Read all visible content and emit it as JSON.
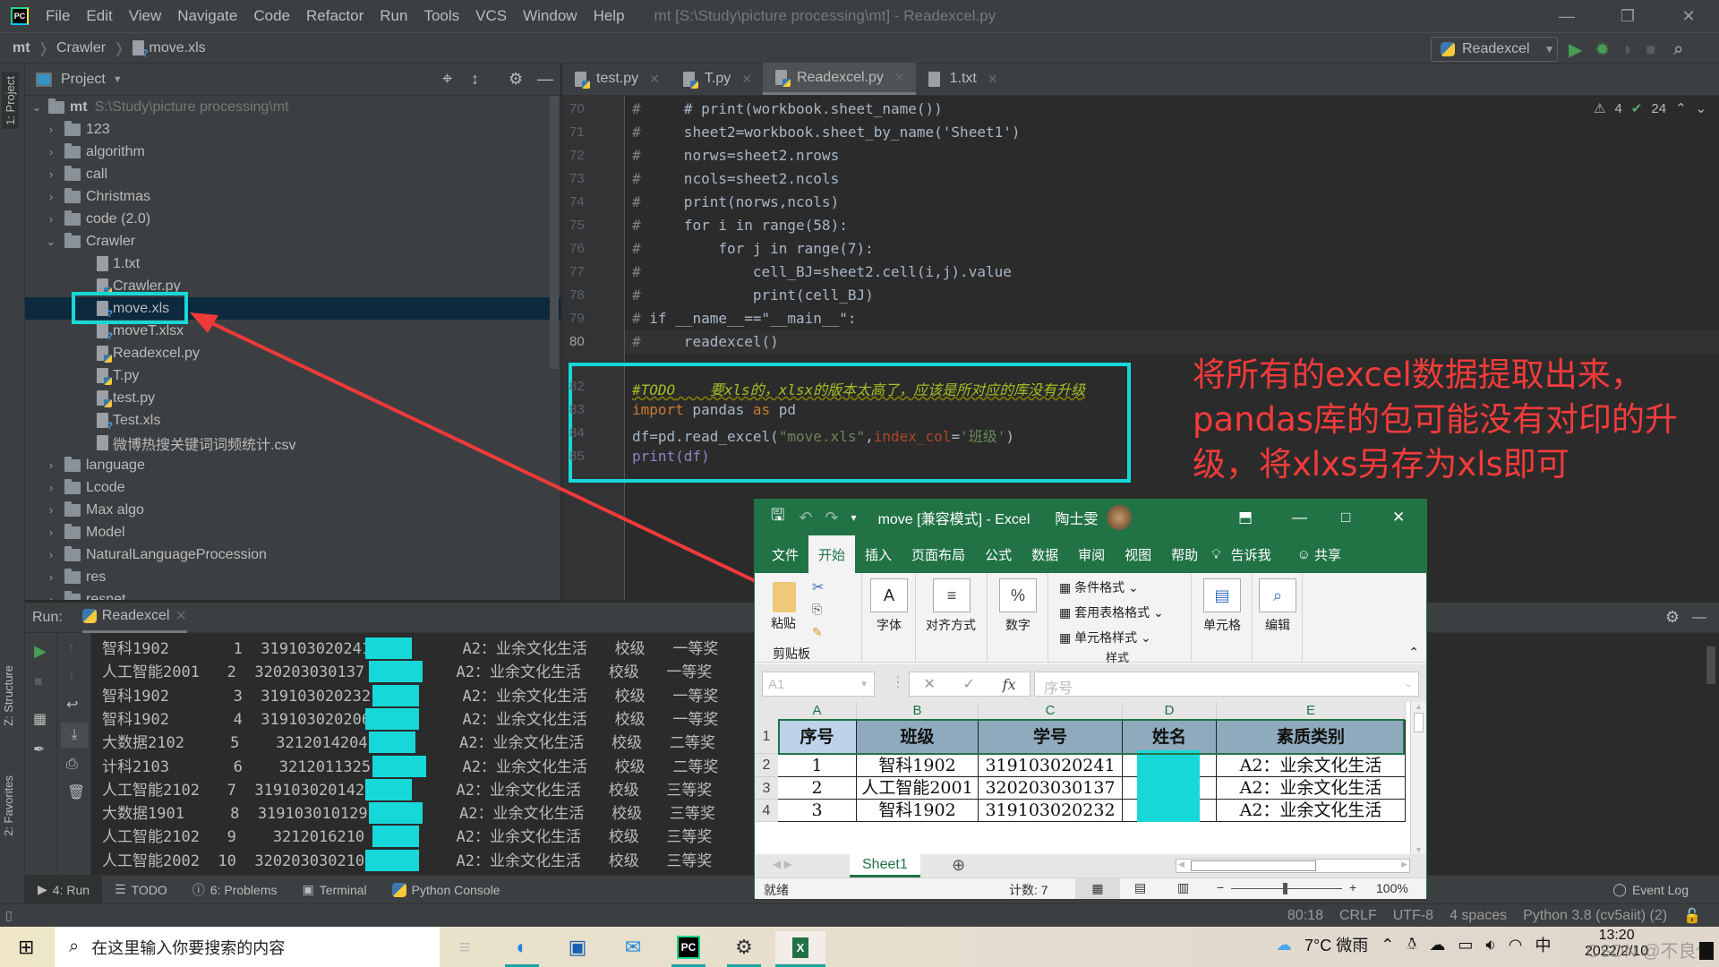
{
  "app": {
    "menu": [
      "File",
      "Edit",
      "View",
      "Navigate",
      "Code",
      "Refactor",
      "Run",
      "Tools",
      "VCS",
      "Window",
      "Help"
    ],
    "window_title": "mt [S:\\Study\\picture processing\\mt] - Readexcel.py",
    "logo": "PC"
  },
  "nav": {
    "breadcrumb": [
      "mt",
      "Crawler",
      "move.xls"
    ],
    "run_config": "Readexcel"
  },
  "tool_windows": {
    "project_tab": "1: Project",
    "structure_tab": "Z: Structure",
    "favorites_tab": "2: Favorites"
  },
  "project": {
    "title": "Project",
    "root_name": "mt",
    "root_path": "S:\\Study\\picture processing\\mt",
    "items": [
      {
        "label": "123",
        "type": "folder",
        "level": 1,
        "expanded": false
      },
      {
        "label": "algorithm",
        "type": "folder",
        "level": 1,
        "expanded": false
      },
      {
        "label": "call",
        "type": "folder",
        "level": 1,
        "expanded": false
      },
      {
        "label": "Christmas",
        "type": "folder",
        "level": 1,
        "expanded": false
      },
      {
        "label": "code   (2.0)",
        "type": "folder",
        "level": 1,
        "expanded": false
      },
      {
        "label": "Crawler",
        "type": "folder",
        "level": 1,
        "expanded": true
      },
      {
        "label": "1.txt",
        "type": "txt",
        "level": 2
      },
      {
        "label": "Crawler.py",
        "type": "py",
        "level": 2
      },
      {
        "label": "move.xls",
        "type": "unknown",
        "level": 2,
        "selected": true
      },
      {
        "label": "moveT.xlsx",
        "type": "unknown",
        "level": 2
      },
      {
        "label": "Readexcel.py",
        "type": "py",
        "level": 2
      },
      {
        "label": "T.py",
        "type": "py",
        "level": 2
      },
      {
        "label": "test.py",
        "type": "py",
        "level": 2
      },
      {
        "label": "Test.xls",
        "type": "unknown",
        "level": 2
      },
      {
        "label": "微博热搜关键词词频统计.csv",
        "type": "txt",
        "level": 2
      },
      {
        "label": "language",
        "type": "folder",
        "level": 1,
        "expanded": false
      },
      {
        "label": "Lcode",
        "type": "folder",
        "level": 1,
        "expanded": false
      },
      {
        "label": "Max algo",
        "type": "folder",
        "level": 1,
        "expanded": false
      },
      {
        "label": "Model",
        "type": "folder",
        "level": 1,
        "expanded": false
      },
      {
        "label": "NaturalLanguageProcession",
        "type": "folder",
        "level": 1,
        "expanded": false
      },
      {
        "label": "res",
        "type": "folder",
        "level": 1,
        "expanded": false
      },
      {
        "label": "resnet",
        "type": "folder",
        "level": 1,
        "expanded": false
      }
    ]
  },
  "editor": {
    "tabs": [
      {
        "label": "test.py",
        "type": "py",
        "active": false
      },
      {
        "label": "T.py",
        "type": "py",
        "active": false
      },
      {
        "label": "Readexcel.py",
        "type": "py",
        "active": true
      },
      {
        "label": "1.txt",
        "type": "txt",
        "active": false
      }
    ],
    "warnings": "4",
    "weak_warnings": "24",
    "lines": [
      {
        "n": "70",
        "t": "#     # print(workbook.sheet_name())"
      },
      {
        "n": "71",
        "t": "#     sheet2=workbook.sheet_by_name('Sheet1')"
      },
      {
        "n": "72",
        "t": "#     norws=sheet2.nrows"
      },
      {
        "n": "73",
        "t": "#     ncols=sheet2.ncols"
      },
      {
        "n": "74",
        "t": "#     print(norws,ncols)"
      },
      {
        "n": "75",
        "t": "#     for i in range(58):"
      },
      {
        "n": "76",
        "t": "#         for j in range(7):"
      },
      {
        "n": "77",
        "t": "#             cell_BJ=sheet2.cell(i,j).value"
      },
      {
        "n": "78",
        "t": "#             print(cell_BJ)"
      },
      {
        "n": "79",
        "t": "# if __name__==\"__main__\":"
      },
      {
        "n": "80",
        "t": "#     readexcel()"
      }
    ],
    "boxed_lines": [
      {
        "n": "82",
        "todo": "#TODO",
        "text": "    要xls的，xlsx的版本太高了，应该是所对应的库没有升级"
      },
      {
        "n": "83",
        "kw1": "import",
        "mid": " pandas ",
        "kw2": "as",
        "end": " pd"
      },
      {
        "n": "84",
        "pre": "df=pd.read_excel(",
        "s1": "\"move.xls\"",
        "comma": ",",
        "kwarg": "index_col",
        "eq": "=",
        "s2": "'班级'",
        "close": ")"
      },
      {
        "n": "85",
        "t": "print(df)"
      }
    ],
    "annotation": "将所有的excel数据提取出来，pandas库的包可能没有对印的升级，将xlxs另存为xls即可"
  },
  "run": {
    "label": "Run:",
    "tab": "Readexcel",
    "rows": [
      {
        "cls": "智科1902",
        "no": "1",
        "id": "319103020241",
        "cat": "A2：业余文化生活",
        "level": "校级",
        "award": "一等奖"
      },
      {
        "cls": "人工智能2001",
        "no": "2",
        "id": "320203030137",
        "cat": "A2：业余文化生活",
        "level": "校级",
        "award": "一等奖"
      },
      {
        "cls": "智科1902",
        "no": "3",
        "id": "319103020232",
        "cat": "A2：业余文化生活",
        "level": "校级",
        "award": "一等奖"
      },
      {
        "cls": "智科1902",
        "no": "4",
        "id": "319103020206",
        "cat": "A2：业余文化生活",
        "level": "校级",
        "award": "一等奖"
      },
      {
        "cls": "大数据2102",
        "no": "5",
        "id": "3212014204",
        "cat": "A2：业余文化生活",
        "level": "校级",
        "award": "二等奖"
      },
      {
        "cls": "计科2103",
        "no": "6",
        "id": "3212011325",
        "cat": "A2：业余文化生活",
        "level": "校级",
        "award": "二等奖"
      },
      {
        "cls": "人工智能2102",
        "no": "7",
        "id": "319103020142",
        "cat": "A2：业余文化生活",
        "level": "校级",
        "award": "三等奖"
      },
      {
        "cls": "大数据1901",
        "no": "8",
        "id": "319103010129",
        "cat": "A2：业余文化生活",
        "level": "校级",
        "award": "三等奖"
      },
      {
        "cls": "人工智能2102",
        "no": "9",
        "id": "3212016210",
        "cat": "A2：业余文化生活",
        "level": "校级",
        "award": "三等奖"
      },
      {
        "cls": "人工智能2002",
        "no": "10",
        "id": "320203030210",
        "cat": "A2：业余文化生活",
        "level": "校级",
        "award": "三等奖"
      }
    ]
  },
  "bottom_tabs": [
    "4: Run",
    "TODO",
    "6: Problems",
    "Terminal",
    "Python Console"
  ],
  "event_log": "Event Log",
  "status": [
    "80:18",
    "CRLF",
    "UTF-8",
    "4 spaces",
    "Python 3.8 (cv5aiit) (2)"
  ],
  "excel": {
    "title": "move  [兼容模式]  -  Excel",
    "user": "陶士雯",
    "menu": [
      "文件",
      "开始",
      "插入",
      "页面布局",
      "公式",
      "数据",
      "审阅",
      "视图",
      "帮助",
      "告诉我",
      "共享"
    ],
    "active_menu": "开始",
    "ribbon": {
      "paste": "粘贴",
      "clipboard": "剪贴板",
      "font": "字体",
      "align": "对齐方式",
      "number": "数字",
      "cond_format": "条件格式",
      "table_format": "套用表格格式",
      "cell_style": "单元格样式",
      "styles": "样式",
      "cells": "单元格",
      "edit": "编辑"
    },
    "name_box": "A1",
    "formula": "序号",
    "columns": [
      "A",
      "B",
      "C",
      "D",
      "E"
    ],
    "rows": [
      {
        "r": "1",
        "cells": [
          "序号",
          "班级",
          "学号",
          "姓名",
          "素质类别"
        ]
      },
      {
        "r": "2",
        "cells": [
          "1",
          "智科1902",
          "319103020241",
          "",
          "A2：业余文化生活"
        ]
      },
      {
        "r": "3",
        "cells": [
          "2",
          "人工智能2001",
          "320203030137",
          "",
          "A2：业余文化生活"
        ]
      },
      {
        "r": "4",
        "cells": [
          "3",
          "智科1902",
          "319103020232",
          "",
          "A2：业余文化生活"
        ]
      }
    ],
    "sheet_tab": "Sheet1",
    "status_ready": "就绪",
    "count": "计数: 7",
    "zoom": "100%"
  },
  "taskbar": {
    "search_placeholder": "在这里输入你要搜索的内容",
    "weather": "7°C  微雨",
    "ime": "中",
    "time": "13:20",
    "date": "2022/2/10",
    "watermark": "CSDN @不良使"
  }
}
